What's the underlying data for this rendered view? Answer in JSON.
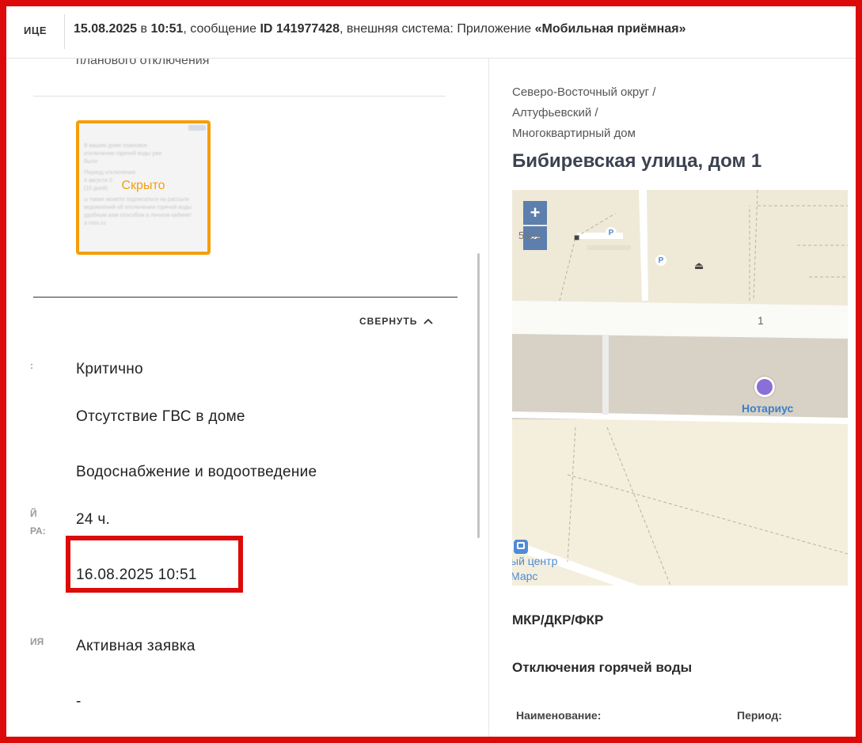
{
  "header": {
    "crumb_tail": "ИЦЕ",
    "datetime_date": "15.08.2025",
    "word_in": "в",
    "datetime_time": "10:51",
    "message_prefix": ", сообщение ",
    "message_id": "ID 141977428",
    "system_prefix": ", внешняя система: Приложение ",
    "system_name": "«Мобильная приёмная»"
  },
  "left": {
    "cut_text": "планового отключения",
    "attachment_hidden_label": "Скрыто",
    "attachment_preview_lines": [
      "В вашем доме плановое",
      "отключение горячей воды уже",
      "было",
      "Период отключения",
      "4 августа 0",
      "(10 дней)",
      "ы также можете подписаться на рассылк",
      "ведомлений об отключении горячей воды",
      "удобным вам способом в личном кабинет",
      "a mos.ru"
    ],
    "collapse_label": "СВЕРНУТЬ",
    "partial_labels": [
      ":",
      "Й",
      "РА:",
      "ИЯ"
    ],
    "fields": {
      "priority": "Критично",
      "problem": "Отсутствие ГВС в доме",
      "category": "Водоснабжение и водоотведение",
      "deadline": "24 ч.",
      "due_date": "16.08.2025 10:51",
      "status": "Активная заявка",
      "extra": "-"
    }
  },
  "right": {
    "address_line1": "Северо-Восточный округ /",
    "address_line2": "Алтуфьевский / Многоквартирный дом",
    "house_title": "Бибиревская улица, дом 1",
    "map": {
      "zoom_in": "+",
      "zoom_out": "−",
      "house_number": "1",
      "partial_number": "56с1",
      "parking_label": "P",
      "poi_label": "Нотариус",
      "center_line1": "ый центр",
      "center_line2": "Марс",
      "colors": {
        "background": "#efe9d8",
        "road": "#ffffff",
        "poi": "#8a6fd6",
        "label": "#3f7fc9"
      }
    },
    "section_repair": "МКР/ДКР/ФКР",
    "section_hot_water": "Отключения горячей воды",
    "table_headers": {
      "name": "Наименование:",
      "period": "Период:"
    }
  },
  "colors": {
    "frame": "#dd0a0a",
    "thumb_border": "#f59e0b",
    "zoom_button": "#5c7fae"
  }
}
